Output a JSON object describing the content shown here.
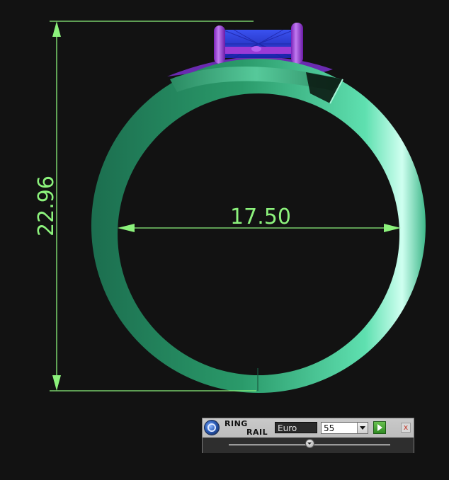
{
  "drawing": {
    "height_dimension": "22.96",
    "inner_diameter_dimension": "17.50",
    "dimension_color": "#8cf27c",
    "band_color": "#2f9a6c",
    "gem_color": "#2a3dd6",
    "prong_color": "#9b3bd6"
  },
  "ring_rail": {
    "title_line1": "RING",
    "title_line2": "RAIL",
    "size_system": "Euro",
    "size_value": "55",
    "slider_fraction": 0.5,
    "close_label": "x"
  }
}
